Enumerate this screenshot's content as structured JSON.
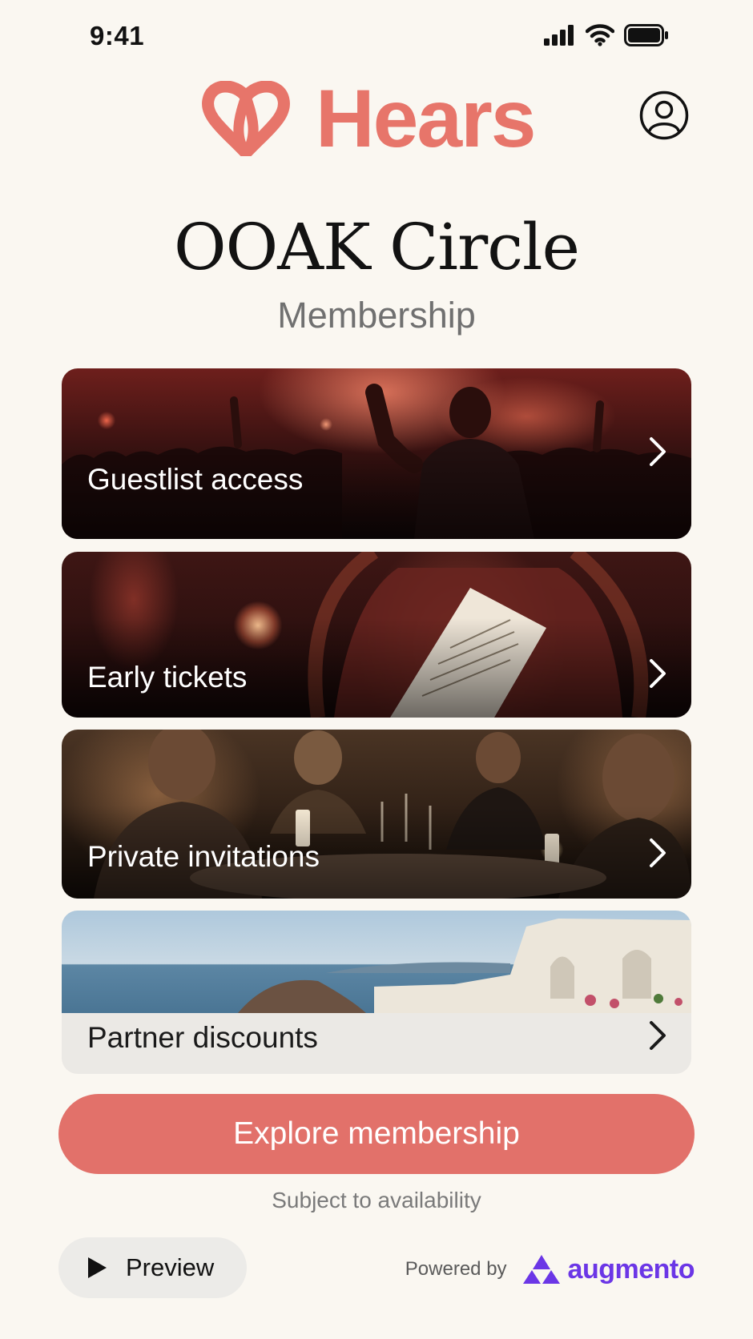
{
  "status_bar": {
    "time": "9:41"
  },
  "header": {
    "brand_name": "Hears"
  },
  "hero": {
    "title": "OOAK Circle",
    "subtitle": "Membership"
  },
  "benefits": [
    {
      "label": "Guestlist access"
    },
    {
      "label": "Early tickets"
    },
    {
      "label": "Private invitations"
    },
    {
      "label": "Partner discounts"
    }
  ],
  "cta": {
    "label": "Explore membership",
    "note": "Subject to availability"
  },
  "footer": {
    "preview_label": "Preview",
    "powered_by": "Powered by",
    "partner_name": "augmento"
  },
  "colors": {
    "brand": "#e7756a",
    "cta": "#e2716a",
    "background": "#faf7f1",
    "partner": "#6b36e6"
  },
  "icons": [
    "signal-icon",
    "wifi-icon",
    "battery-icon",
    "hears-logo-icon",
    "profile-icon",
    "chevron-right-icon",
    "play-icon",
    "augmento-logo-icon"
  ]
}
